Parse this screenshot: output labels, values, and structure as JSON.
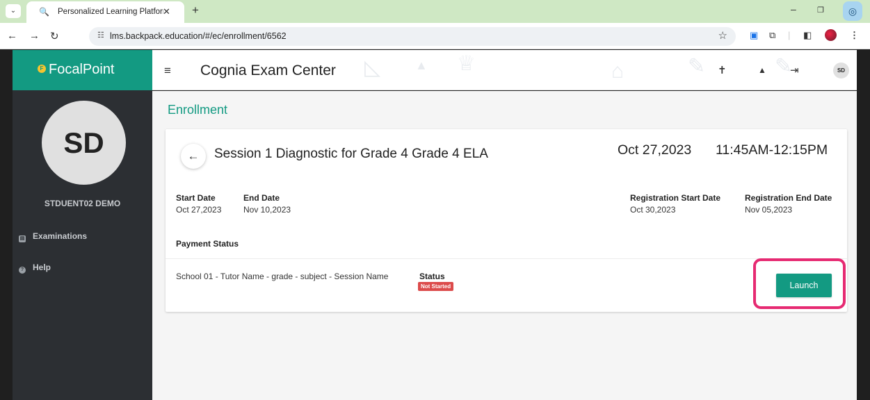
{
  "browser": {
    "tab_title": "Personalized Learning Platform",
    "new_tab_icon": "plus-icon",
    "url": "lms.backpack.education/#/ec/enrollment/6562"
  },
  "app": {
    "brand": "FocalPoint",
    "title": "Cognia Exam Center",
    "user_initials": "SD",
    "user_name": "STDUENT02 DEMO"
  },
  "sidebar": {
    "items": [
      {
        "label": "Examinations",
        "icon": "exam-icon"
      },
      {
        "label": "Help",
        "icon": "help-icon"
      }
    ]
  },
  "page": {
    "title": "Enrollment"
  },
  "session": {
    "title": "Session 1 Diagnostic for Grade 4 Grade 4 ELA",
    "date": "Oct 27,2023",
    "time": "11:45AM-12:15PM",
    "fields": [
      {
        "label": "Start Date",
        "value": "Oct 27,2023"
      },
      {
        "label": "End Date",
        "value": "Nov 10,2023"
      },
      {
        "label": "Registration Start Date",
        "value": "Oct 30,2023"
      },
      {
        "label": "Registration End Date",
        "value": "Nov 05,2023"
      }
    ],
    "payment_label": "Payment Status",
    "row": {
      "name": "School 01 - Tutor Name - grade - subject - Session Name",
      "status_label": "Status",
      "status_value": "Not Started",
      "action": "Launch"
    }
  },
  "colors": {
    "accent": "#139a82",
    "status_not_started": "#dc4b4b",
    "highlight": "#e62a72"
  }
}
